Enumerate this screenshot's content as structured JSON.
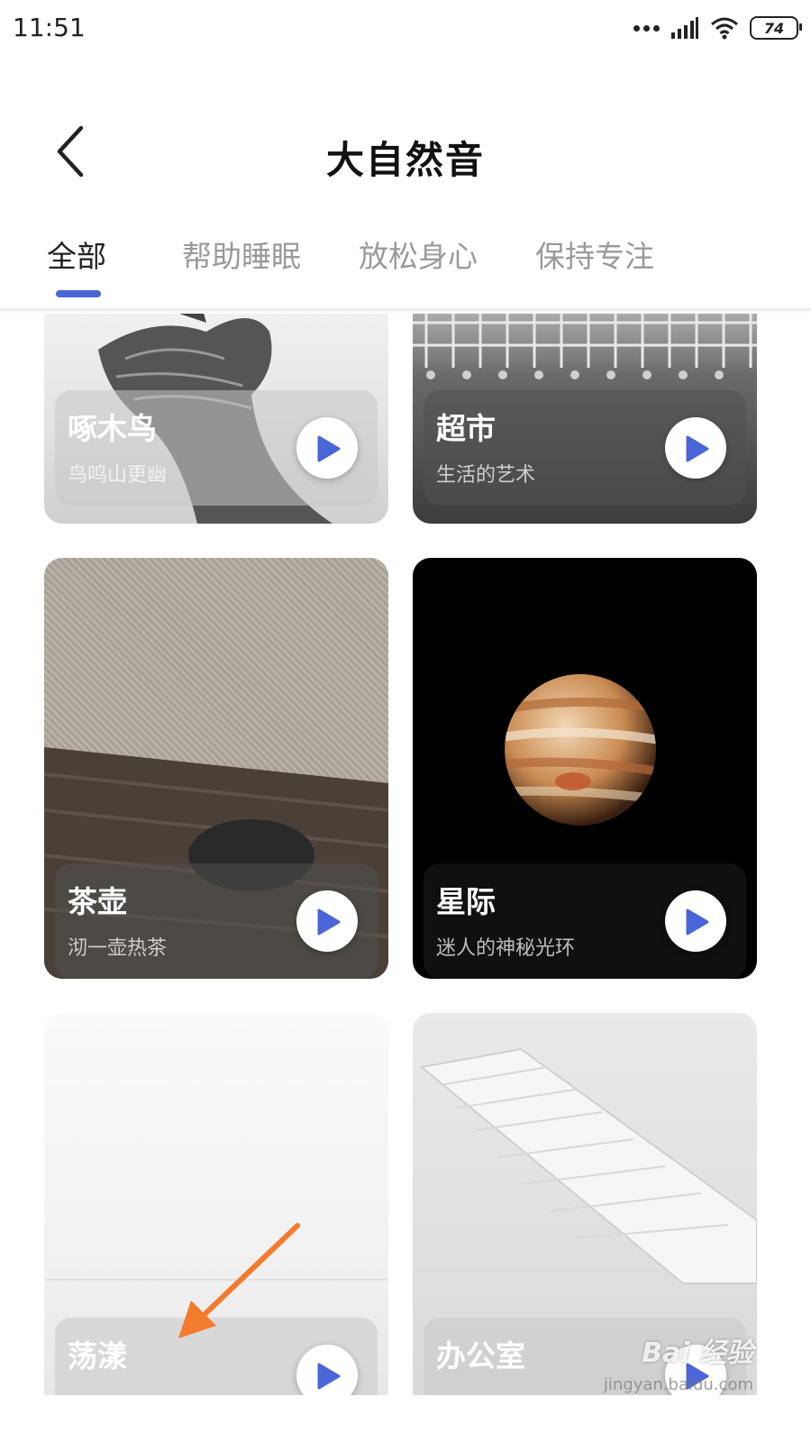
{
  "status_bar": {
    "time": "11:51",
    "battery": "74"
  },
  "header": {
    "title": "大自然音"
  },
  "tabs": [
    {
      "label": "全部",
      "active": true
    },
    {
      "label": "帮助睡眠",
      "active": false
    },
    {
      "label": "放松身心",
      "active": false
    },
    {
      "label": "保持专注",
      "active": false
    }
  ],
  "cards": [
    {
      "title": "啄木鸟",
      "subtitle": "鸟鸣山更幽"
    },
    {
      "title": "超市",
      "subtitle": "生活的艺术"
    },
    {
      "title": "茶壶",
      "subtitle": "沏一壶热茶"
    },
    {
      "title": "星际",
      "subtitle": "迷人的神秘光环"
    },
    {
      "title": "荡漾",
      "subtitle": ""
    },
    {
      "title": "办公室",
      "subtitle": ""
    }
  ],
  "colors": {
    "accent": "#4a65d8",
    "arrow": "#f47a2e"
  },
  "watermark": {
    "text": "Bai 经验",
    "sub": "jingyan.baidu.com"
  }
}
